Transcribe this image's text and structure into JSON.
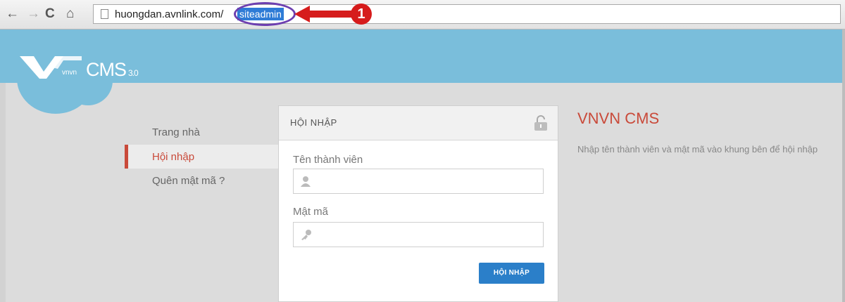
{
  "browser": {
    "url_host": "huongdan.avnlink.com/",
    "url_path": "siteadmin",
    "annotation_number": "1"
  },
  "logo": {
    "brand": "CMS",
    "version": "3.0",
    "small_text": "vnvn"
  },
  "nav": {
    "items": [
      {
        "label": "Trang nhà"
      },
      {
        "label": "Hội nhập"
      },
      {
        "label": "Quên mật mã ?"
      }
    ]
  },
  "login": {
    "title": "HỘI NHẬP",
    "username_label": "Tên thành viên",
    "password_label": "Mật mã",
    "button_label": "HỘI NHẬP"
  },
  "info": {
    "title": "VNVN CMS",
    "description": "Nhập tên thành viên và mật mã vào khung bên để hội nhập"
  },
  "colors": {
    "header": "#7abedb",
    "accent": "#c94a3a",
    "button": "#2b7fc9"
  }
}
